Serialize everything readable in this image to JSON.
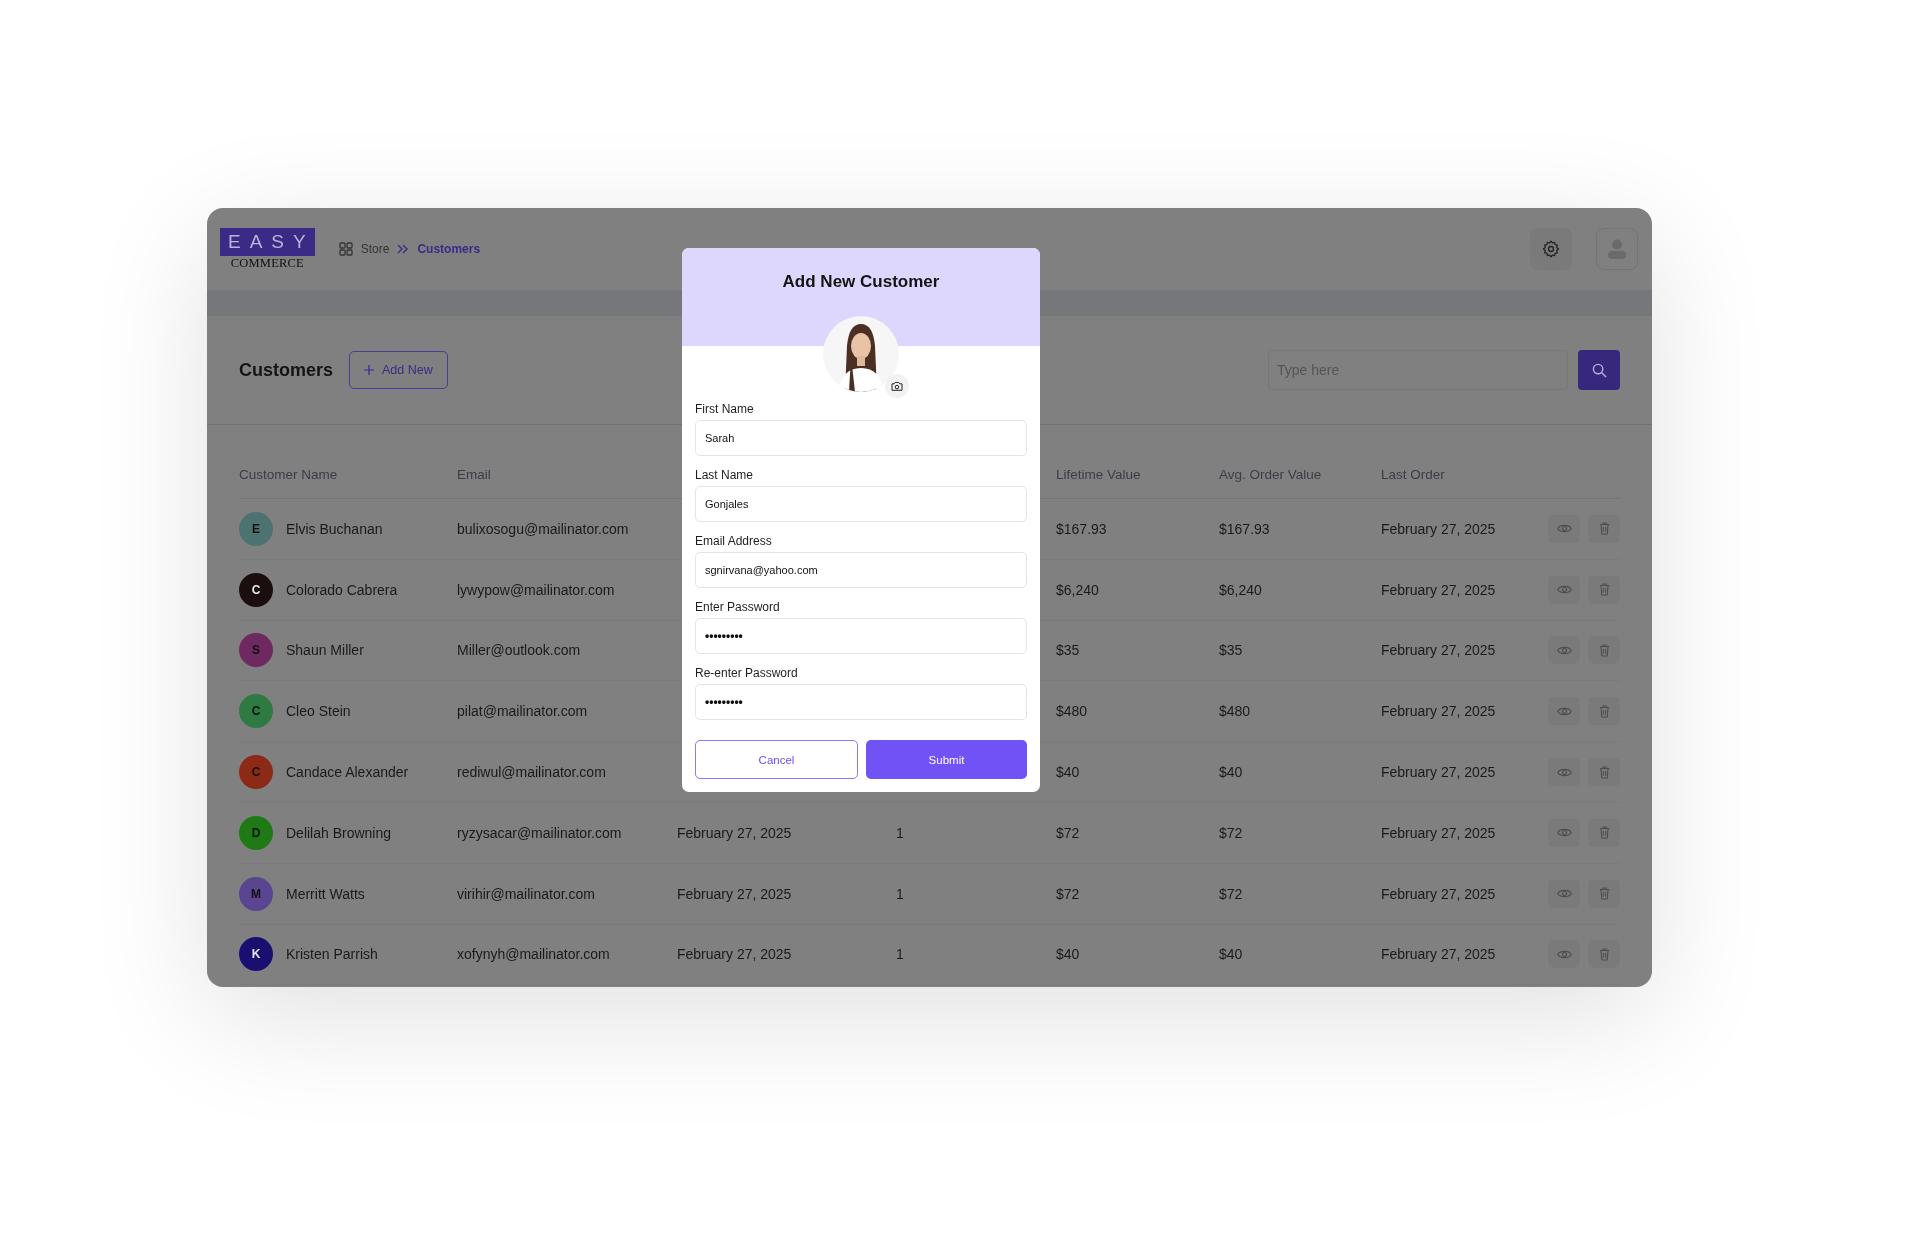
{
  "logo": {
    "top": "EASY",
    "bottom": "COMMERCE"
  },
  "breadcrumb": [
    {
      "label": "Store",
      "selected": false
    },
    {
      "label": "Customers",
      "selected": true
    }
  ],
  "page": {
    "title": "Customers",
    "add_button": "Add New",
    "search": {
      "placeholder": "Type here"
    }
  },
  "table": {
    "columns": {
      "name": "Customer Name",
      "email": "Email",
      "lifetime": "Lifetime Value",
      "avg": "Avg. Order Value",
      "last": "Last Order"
    },
    "rows": [
      {
        "initial": "E",
        "color": "#4d7272",
        "name": "Elvis Buchanan",
        "email": "bulixosogu@mailinator.com",
        "lifetime": "$167.93",
        "avg": "$167.93",
        "last": "February 27, 2025"
      },
      {
        "initial": "C",
        "color": "#1a0e0f",
        "name": "Colorado Cabrera",
        "email": "lywypow@mailinator.com",
        "lifetime": "$6,240",
        "avg": "$6,240",
        "last": "February 27, 2025"
      },
      {
        "initial": "S",
        "color": "#6e2a60",
        "name": "Shaun Miller",
        "email": "Miller@outlook.com",
        "lifetime": "$35",
        "avg": "$35",
        "last": "February 27, 2025"
      },
      {
        "initial": "C",
        "color": "#2e7a42",
        "name": "Cleo Stein",
        "email": "pilat@mailinator.com",
        "lifetime": "$480",
        "avg": "$480",
        "last": "February 27, 2025"
      },
      {
        "initial": "C",
        "color": "#8c2a17",
        "name": "Candace Alexander",
        "email": "rediwul@mailinator.com",
        "lifetime": "$40",
        "avg": "$40",
        "last": "February 27, 2025"
      },
      {
        "initial": "D",
        "color": "#1f7a16",
        "name": "Delilah Browning",
        "email": "ryzysacar@mailinator.com",
        "column_3": "February 27, 2025",
        "column_4": "1",
        "lifetime": "$72",
        "avg": "$72",
        "last": "February 27, 2025"
      },
      {
        "initial": "M",
        "color": "#5a4590",
        "name": "Merritt Watts",
        "email": "virihir@mailinator.com",
        "column_3": "February 27, 2025",
        "column_4": "1",
        "lifetime": "$72",
        "avg": "$72",
        "last": "February 27, 2025"
      },
      {
        "initial": "K",
        "color": "#1a0f70",
        "name": "Kristen Parrish",
        "email": "xofynyh@mailinator.com",
        "column_3": "February 27, 2025",
        "column_4": "1",
        "lifetime": "$40",
        "avg": "$40",
        "last": "February 27, 2025"
      }
    ]
  },
  "modal": {
    "title": "Add New Customer",
    "fields": [
      {
        "label": "First Name",
        "value": "Sarah",
        "kind": "text"
      },
      {
        "label": "Last Name",
        "value": "Gonjales",
        "kind": "text"
      },
      {
        "label": "Email Address",
        "value": "sgnirvana@yahoo.com",
        "kind": "text"
      },
      {
        "label": "Enter Password",
        "value": "•••••••••",
        "kind": "password"
      },
      {
        "label": "Re-enter Password",
        "value": "•••••••••",
        "kind": "password"
      }
    ],
    "cancel": "Cancel",
    "submit": "Submit"
  }
}
